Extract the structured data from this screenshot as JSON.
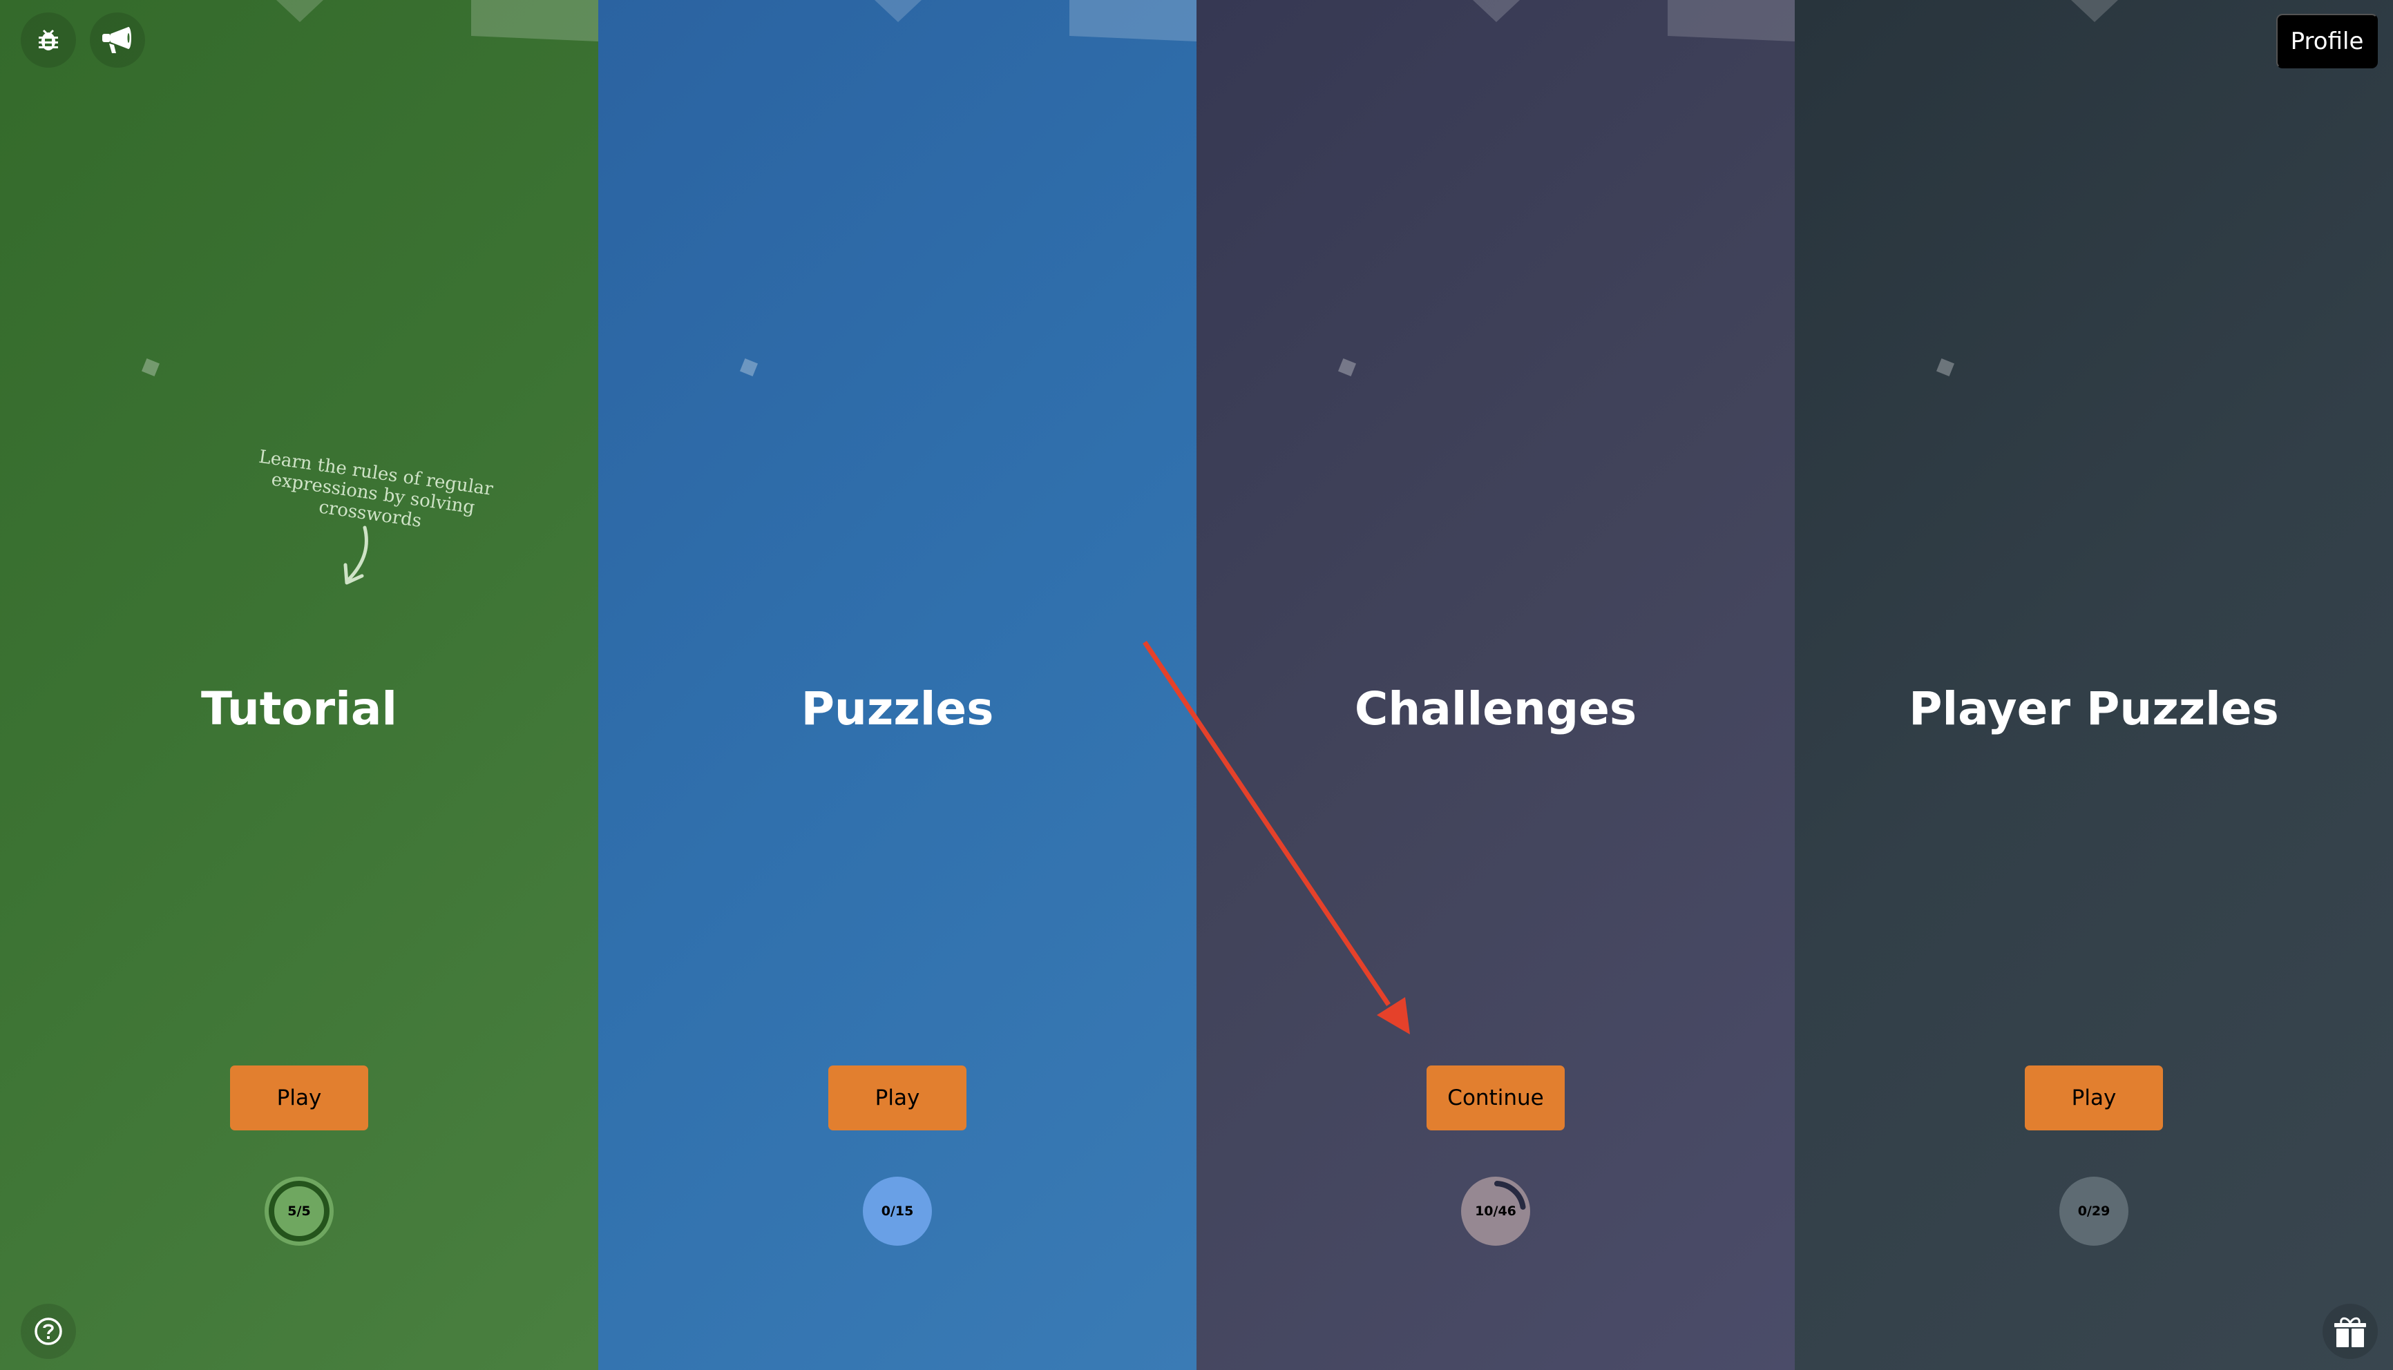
{
  "header": {
    "profile_label": "Profile",
    "icons": [
      "bug-icon",
      "megaphone-icon"
    ]
  },
  "footer": {
    "help_icon": "help-icon",
    "gift_icon": "gift-icon"
  },
  "panels": [
    {
      "title": "Tutorial",
      "button_label": "Play",
      "progress_text": "5/5",
      "progress": {
        "done": 5,
        "total": 5
      },
      "hint": "Learn the rules of regular expressions by solving crosswords",
      "color": "#3c7333"
    },
    {
      "title": "Puzzles",
      "button_label": "Play",
      "progress_text": "0/15",
      "progress": {
        "done": 0,
        "total": 15
      },
      "color": "#3070ad"
    },
    {
      "title": "Challenges",
      "button_label": "Continue",
      "progress_text": "10/46",
      "progress": {
        "done": 10,
        "total": 46
      },
      "color": "#42445b"
    },
    {
      "title": "Player Puzzles",
      "button_label": "Play",
      "progress_text": "0/29",
      "progress": {
        "done": 0,
        "total": 29
      },
      "color": "#323f48"
    }
  ],
  "colors": {
    "button": "#e27f2f",
    "annotation_arrow": "#e5412a"
  },
  "annotation": {
    "type": "arrow",
    "points_to": "challenges-continue-button"
  }
}
